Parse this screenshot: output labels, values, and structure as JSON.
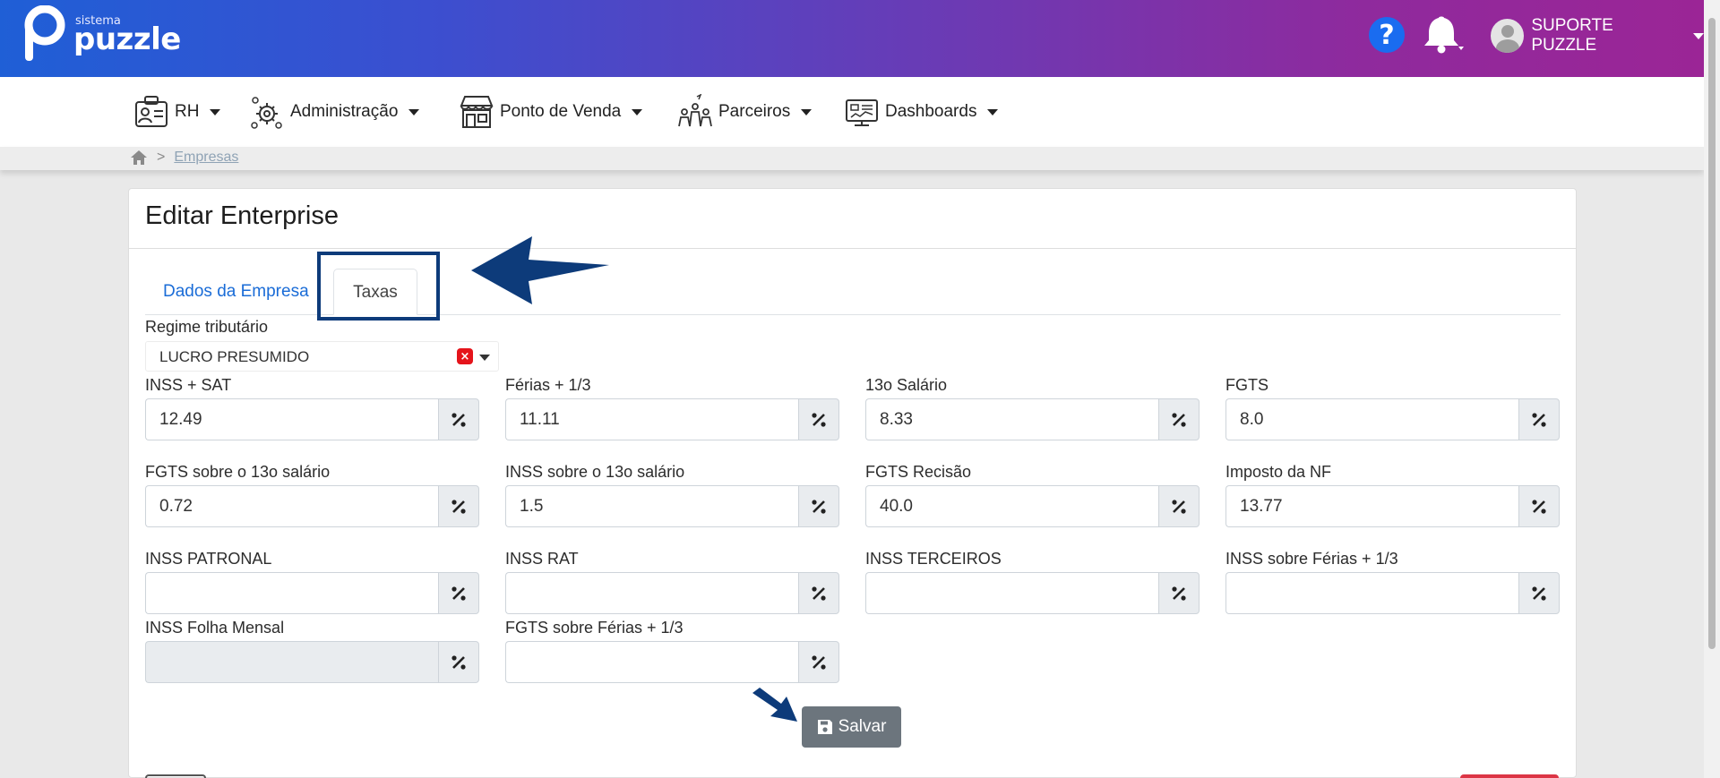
{
  "header": {
    "logo_small": "sistema",
    "logo_big": "puzzle",
    "help_glyph": "?",
    "user_name": "SUPORTE PUZZLE",
    "icons": [
      "help-icon",
      "bell-icon",
      "avatar-icon"
    ]
  },
  "nav": {
    "items": [
      {
        "label": "RH",
        "icon": "id-card-icon"
      },
      {
        "label": "Administração",
        "icon": "gear-admin-icon"
      },
      {
        "label": "Ponto de Venda",
        "icon": "store-icon"
      },
      {
        "label": "Parceiros",
        "icon": "partners-icon"
      },
      {
        "label": "Dashboards",
        "icon": "dashboard-icon"
      }
    ]
  },
  "breadcrumb": {
    "separator": ">",
    "current": "Empresas"
  },
  "card": {
    "title": "Editar Enterprise"
  },
  "tabs": [
    {
      "label": "Dados da Empresa",
      "active": false
    },
    {
      "label": "Taxas",
      "active": true
    }
  ],
  "regime": {
    "label": "Regime tributário",
    "value": "LUCRO PRESUMIDO",
    "clear_glyph": "×"
  },
  "fields": [
    {
      "label": "INSS + SAT",
      "value": "12.49"
    },
    {
      "label": "Férias + 1/3",
      "value": "11.11"
    },
    {
      "label": "13o Salário",
      "value": "8.33"
    },
    {
      "label": "FGTS",
      "value": "8.0"
    },
    {
      "label": "FGTS sobre o 13o salário",
      "value": "0.72"
    },
    {
      "label": "INSS sobre o 13o salário",
      "value": "1.5"
    },
    {
      "label": "FGTS Recisão",
      "value": "40.0"
    },
    {
      "label": "Imposto da NF",
      "value": "13.77"
    },
    {
      "label": "INSS PATRONAL",
      "value": ""
    },
    {
      "label": "INSS RAT",
      "value": ""
    },
    {
      "label": "INSS TERCEIROS",
      "value": ""
    },
    {
      "label": "INSS sobre Férias + 1/3",
      "value": ""
    },
    {
      "label": "INSS Folha Mensal",
      "value": "",
      "disabled": true
    },
    {
      "label": "FGTS sobre Férias + 1/3",
      "value": ""
    }
  ],
  "save": {
    "label": "Salvar",
    "icon": "floppy-disk-icon"
  },
  "colors": {
    "header_start": "#1f5fd6",
    "header_end": "#9b2596",
    "tab_link": "#1a6cd7",
    "annotation": "#0d3b7a",
    "save_button": "#6c757d",
    "clear_red": "#e5141b"
  }
}
